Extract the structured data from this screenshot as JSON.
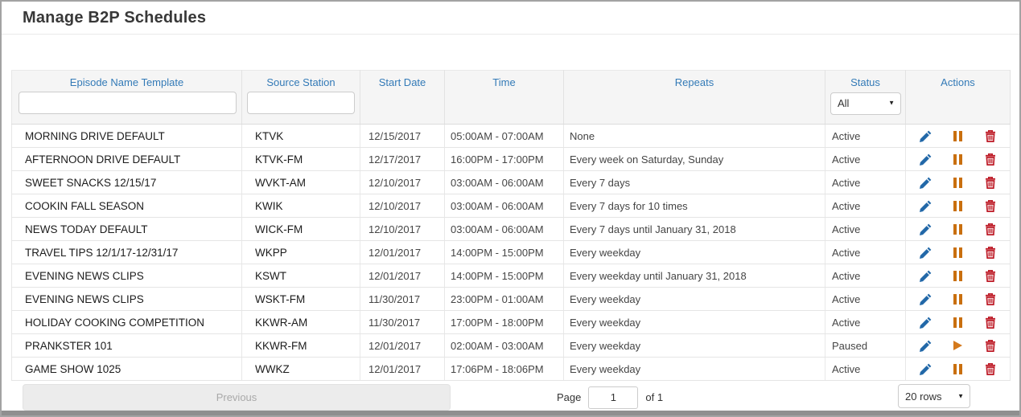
{
  "page": {
    "title": "Manage B2P Schedules"
  },
  "colors": {
    "header_text": "#337ab7",
    "edit_icon": "#2268a8",
    "pause_icon": "#c96f0e",
    "play_icon": "#d4791c",
    "delete_icon": "#bd1a26"
  },
  "table": {
    "columns": [
      "Episode Name Template",
      "Source Station",
      "Start Date",
      "Time",
      "Repeats",
      "Status",
      "Actions"
    ],
    "filters": {
      "episode_placeholder": "",
      "station_placeholder": "",
      "status_value": "All"
    },
    "rows": [
      {
        "episode": "MORNING DRIVE DEFAULT",
        "station": "KTVK",
        "start_date": "12/15/2017",
        "time": "05:00AM - 07:00AM",
        "repeats": "None",
        "status": "Active",
        "toggle": "pause"
      },
      {
        "episode": "AFTERNOON DRIVE DEFAULT",
        "station": "KTVK-FM",
        "start_date": "12/17/2017",
        "time": "16:00PM - 17:00PM",
        "repeats": "Every week on Saturday, Sunday",
        "status": "Active",
        "toggle": "pause"
      },
      {
        "episode": "SWEET SNACKS 12/15/17",
        "station": "WVKT-AM",
        "start_date": "12/10/2017",
        "time": "03:00AM - 06:00AM",
        "repeats": "Every 7 days",
        "status": "Active",
        "toggle": "pause"
      },
      {
        "episode": "COOKIN FALL SEASON",
        "station": "KWIK",
        "start_date": "12/10/2017",
        "time": "03:00AM - 06:00AM",
        "repeats": "Every 7 days for 10 times",
        "status": "Active",
        "toggle": "pause"
      },
      {
        "episode": "NEWS TODAY DEFAULT",
        "station": "WICK-FM",
        "start_date": "12/10/2017",
        "time": "03:00AM - 06:00AM",
        "repeats": "Every 7 days until January 31, 2018",
        "status": "Active",
        "toggle": "pause"
      },
      {
        "episode": "TRAVEL TIPS 12/1/17-12/31/17",
        "station": "WKPP",
        "start_date": "12/01/2017",
        "time": "14:00PM - 15:00PM",
        "repeats": "Every weekday",
        "status": "Active",
        "toggle": "pause"
      },
      {
        "episode": "EVENING NEWS CLIPS",
        "station": "KSWT",
        "start_date": "12/01/2017",
        "time": "14:00PM - 15:00PM",
        "repeats": "Every weekday until January 31, 2018",
        "status": "Active",
        "toggle": "pause"
      },
      {
        "episode": "EVENING NEWS CLIPS",
        "station": "WSKT-FM",
        "start_date": "11/30/2017",
        "time": "23:00PM - 01:00AM",
        "repeats": "Every weekday",
        "status": "Active",
        "toggle": "pause"
      },
      {
        "episode": "HOLIDAY COOKING COMPETITION",
        "station": "KKWR-AM",
        "start_date": "11/30/2017",
        "time": "17:00PM - 18:00PM",
        "repeats": "Every weekday",
        "status": "Active",
        "toggle": "pause"
      },
      {
        "episode": "PRANKSTER 101",
        "station": "KKWR-FM",
        "start_date": "12/01/2017",
        "time": "02:00AM - 03:00AM",
        "repeats": "Every weekday",
        "status": "Paused",
        "toggle": "play"
      },
      {
        "episode": "GAME SHOW 1025",
        "station": "WWKZ",
        "start_date": "12/01/2017",
        "time": "17:06PM - 18:06PM",
        "repeats": "Every weekday",
        "status": "Active",
        "toggle": "pause"
      }
    ]
  },
  "footer": {
    "previous_label": "Previous",
    "page_label": "Page",
    "page_value": "1",
    "page_total_label": "of 1",
    "rows_per_page": "20 rows"
  }
}
